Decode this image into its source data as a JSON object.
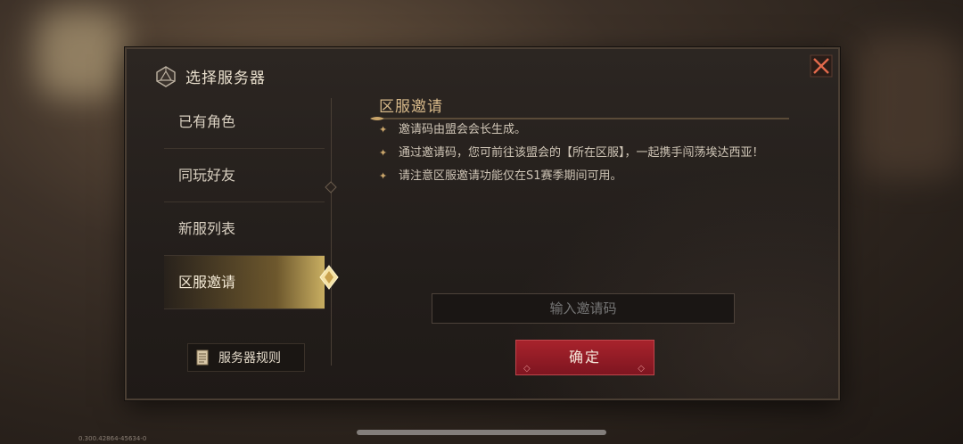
{
  "window": {
    "title": "选择服务器"
  },
  "sidebar": {
    "items": [
      {
        "label": "已有角色"
      },
      {
        "label": "同玩好友"
      },
      {
        "label": "新服列表"
      },
      {
        "label": "区服邀请"
      }
    ],
    "active_index": 3,
    "rules_button": "服务器规则"
  },
  "main": {
    "section_title": "区服邀请",
    "bullets": [
      "邀请码由盟会会长生成。",
      "通过邀请码，您可前往该盟会的【所在区服】，一起携手闯荡埃达西亚！",
      "请注意区服邀请功能仅在S1赛季期间可用。"
    ],
    "input": {
      "placeholder": "输入邀请码",
      "value": ""
    },
    "confirm_button": "确定"
  },
  "footer": {
    "version": "0.300.42864-45634-0"
  },
  "colors": {
    "accent_gold": "#d7b98a",
    "confirm_red": "#9c1f28"
  },
  "icons": {
    "title_icon": "d20-dice-icon",
    "close": "close-icon",
    "rules": "scroll-icon"
  }
}
